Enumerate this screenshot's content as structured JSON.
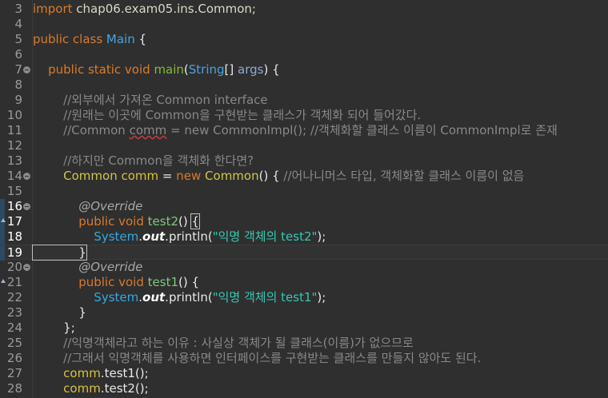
{
  "lines": [
    {
      "n": "3",
      "tokens": [
        {
          "t": "import ",
          "c": "kw"
        },
        {
          "t": "chap06.exam05.ins.Common;",
          "c": "plain"
        }
      ]
    },
    {
      "n": "4",
      "tokens": []
    },
    {
      "n": "5",
      "tokens": [
        {
          "t": "public class ",
          "c": "kw"
        },
        {
          "t": "Main",
          "c": "cls"
        },
        {
          "t": " {",
          "c": "white"
        }
      ]
    },
    {
      "n": "6",
      "tokens": []
    },
    {
      "n": "7",
      "fold": true,
      "tokens": [
        {
          "t": "    public static void ",
          "c": "kw"
        },
        {
          "t": "main",
          "c": "main-fn"
        },
        {
          "t": "(",
          "c": "white"
        },
        {
          "t": "String",
          "c": "cls"
        },
        {
          "t": "[] ",
          "c": "white"
        },
        {
          "t": "args",
          "c": "param"
        },
        {
          "t": ") {",
          "c": "white"
        }
      ]
    },
    {
      "n": "8",
      "tokens": []
    },
    {
      "n": "9",
      "tokens": [
        {
          "t": "        //외부에서 가져온 Common interface",
          "c": "comment"
        }
      ]
    },
    {
      "n": "10",
      "tokens": [
        {
          "t": "        //원래는 이곳에 Common을 구현받는 클래스가 객체화 되어 들어갔다.",
          "c": "comment"
        }
      ]
    },
    {
      "n": "11",
      "tokens": [
        {
          "t": "        //Common ",
          "c": "comment"
        },
        {
          "t": "comm",
          "c": "comment squig"
        },
        {
          "t": " = new CommonImpl(); //객체화할 클래스 이름이 CommonImpl로 존재",
          "c": "comment"
        }
      ]
    },
    {
      "n": "12",
      "tokens": []
    },
    {
      "n": "13",
      "tokens": [
        {
          "t": "        //하지만 Common을 객체화 한다면?",
          "c": "comment"
        }
      ]
    },
    {
      "n": "14",
      "fold": true,
      "tokens": [
        {
          "t": "        ",
          "c": "plain"
        },
        {
          "t": "Common",
          "c": "typ"
        },
        {
          "t": " ",
          "c": "plain"
        },
        {
          "t": "comm",
          "c": "var"
        },
        {
          "t": " = ",
          "c": "white"
        },
        {
          "t": "new ",
          "c": "kw"
        },
        {
          "t": "Common",
          "c": "typ"
        },
        {
          "t": "() { ",
          "c": "white"
        },
        {
          "t": "//어나니머스 타입, 객체화할 클래스 이름이 없음",
          "c": "comment"
        }
      ]
    },
    {
      "n": "15",
      "tokens": []
    },
    {
      "n": "16",
      "fold": true,
      "sel": true,
      "tokens": [
        {
          "t": "            @Override",
          "c": "ann"
        }
      ]
    },
    {
      "n": "17",
      "override": true,
      "sel": true,
      "tokens": [
        {
          "t": "            ",
          "c": "plain"
        },
        {
          "t": "public void ",
          "c": "kw"
        },
        {
          "t": "test2",
          "c": "call"
        },
        {
          "t": "() ",
          "c": "white"
        },
        {
          "t": "{",
          "c": "white brace-box"
        }
      ]
    },
    {
      "n": "18",
      "sel": true,
      "tokens": [
        {
          "t": "                ",
          "c": "plain"
        },
        {
          "t": "System",
          "c": "sys"
        },
        {
          "t": ".",
          "c": "white"
        },
        {
          "t": "out",
          "c": "ital"
        },
        {
          "t": ".println(",
          "c": "white"
        },
        {
          "t": "\"익명 객체의 test2\"",
          "c": "str"
        },
        {
          "t": ");",
          "c": "white"
        }
      ]
    },
    {
      "n": "19",
      "sel": true,
      "current": true,
      "tokens": [
        {
          "t": "            }",
          "c": "white brace-box"
        },
        {
          "t": "",
          "c": "cursor"
        }
      ]
    },
    {
      "n": "20",
      "fold": true,
      "tokens": [
        {
          "t": "            @Override",
          "c": "ann"
        }
      ]
    },
    {
      "n": "21",
      "override": true,
      "tokens": [
        {
          "t": "            ",
          "c": "plain"
        },
        {
          "t": "public void ",
          "c": "kw"
        },
        {
          "t": "test1",
          "c": "call"
        },
        {
          "t": "() {",
          "c": "white"
        }
      ]
    },
    {
      "n": "22",
      "tokens": [
        {
          "t": "                ",
          "c": "plain"
        },
        {
          "t": "System",
          "c": "sys"
        },
        {
          "t": ".",
          "c": "white"
        },
        {
          "t": "out",
          "c": "ital"
        },
        {
          "t": ".println(",
          "c": "white"
        },
        {
          "t": "\"익명 객체의 test1\"",
          "c": "str"
        },
        {
          "t": ");",
          "c": "white"
        }
      ]
    },
    {
      "n": "23",
      "tokens": [
        {
          "t": "            }",
          "c": "white"
        }
      ]
    },
    {
      "n": "24",
      "tokens": [
        {
          "t": "        };",
          "c": "white"
        }
      ]
    },
    {
      "n": "25",
      "tokens": [
        {
          "t": "        //익명객체라고 하는 이유 : 사실상 객체가 될 클래스(이름)가 없으므로",
          "c": "comment"
        }
      ]
    },
    {
      "n": "26",
      "tokens": [
        {
          "t": "        //그래서 익명객체를 사용하면 인터페이스를 구현받는 클래스를 만들지 않아도 된다.",
          "c": "comment"
        }
      ]
    },
    {
      "n": "27",
      "tokens": [
        {
          "t": "        ",
          "c": "plain"
        },
        {
          "t": "comm",
          "c": "var"
        },
        {
          "t": ".test1();",
          "c": "white"
        }
      ]
    },
    {
      "n": "28",
      "tokens": [
        {
          "t": "        ",
          "c": "plain"
        },
        {
          "t": "comm",
          "c": "var"
        },
        {
          "t": ".test2();",
          "c": "white"
        }
      ]
    }
  ]
}
